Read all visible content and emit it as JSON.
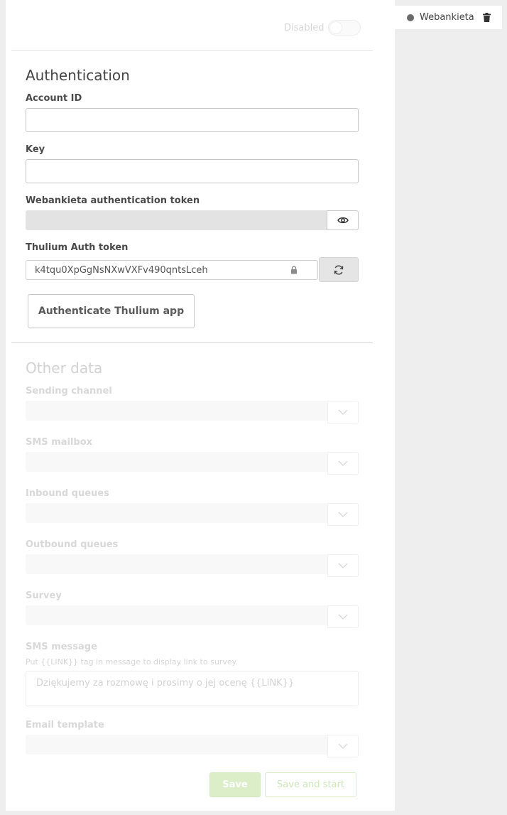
{
  "toggle": {
    "label": "Disabled",
    "on": false
  },
  "authentication": {
    "title": "Authentication",
    "account_id": {
      "label": "Account ID",
      "value": ""
    },
    "key": {
      "label": "Key",
      "value": ""
    },
    "webankieta_token": {
      "label": "Webankieta authentication token",
      "value": "",
      "toggle_icon": "eye-icon"
    },
    "thulium_token": {
      "label": "Thulium Auth token",
      "value": "k4tqu0XpGgNsNXwVXFv490qntsLceh",
      "lock_icon": "lock-icon",
      "refresh_icon": "refresh-icon"
    },
    "authenticate_button": "Authenticate Thulium app"
  },
  "other_data": {
    "title": "Other data",
    "sending_channel": {
      "label": "Sending channel",
      "value": ""
    },
    "sms_mailbox": {
      "label": "SMS mailbox",
      "value": ""
    },
    "inbound_queues": {
      "label": "Inbound queues",
      "value": ""
    },
    "outbound_queues": {
      "label": "Outbound queues",
      "value": ""
    },
    "survey": {
      "label": "Survey",
      "value": ""
    },
    "sms_message": {
      "label": "SMS message",
      "hint": "Put {{LINK}} tag in message to display link to survey.",
      "placeholder": "Dziękujemy za rozmowę i prosimy o jej ocenę {{LINK}}"
    },
    "email_template": {
      "label": "Email template",
      "value": ""
    }
  },
  "actions": {
    "save": "Save",
    "save_and_start": "Save and start"
  },
  "side_tag": {
    "label": "Webankieta",
    "status_color": "#6a6a6a",
    "delete_icon": "trash-icon"
  },
  "colors": {
    "accent_green": "#8cc152",
    "panel_bg": "#ffffff",
    "page_bg": "#eeeeee"
  }
}
